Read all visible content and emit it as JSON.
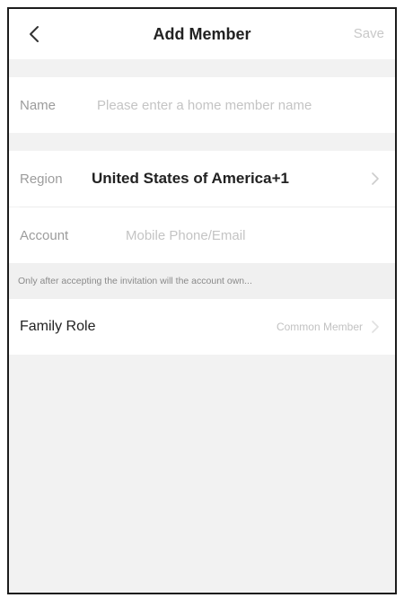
{
  "header": {
    "title": "Add Member",
    "save_label": "Save"
  },
  "form": {
    "name": {
      "label": "Name",
      "placeholder": "Please enter a home member name"
    },
    "region": {
      "label": "Region",
      "value": "United States of America+1"
    },
    "account": {
      "label": "Account",
      "placeholder": "Mobile Phone/Email"
    },
    "notice": "Only after accepting the invitation will the account own...",
    "family_role": {
      "label": "Family Role",
      "value": "Common Member"
    }
  },
  "icons": {
    "back": "chevron-left-icon",
    "chevron": "chevron-right-icon"
  },
  "colors": {
    "text_primary": "#222222",
    "text_muted": "#9c9c9c",
    "placeholder": "#c4c4c4",
    "background": "#f2f2f2",
    "surface": "#ffffff"
  }
}
